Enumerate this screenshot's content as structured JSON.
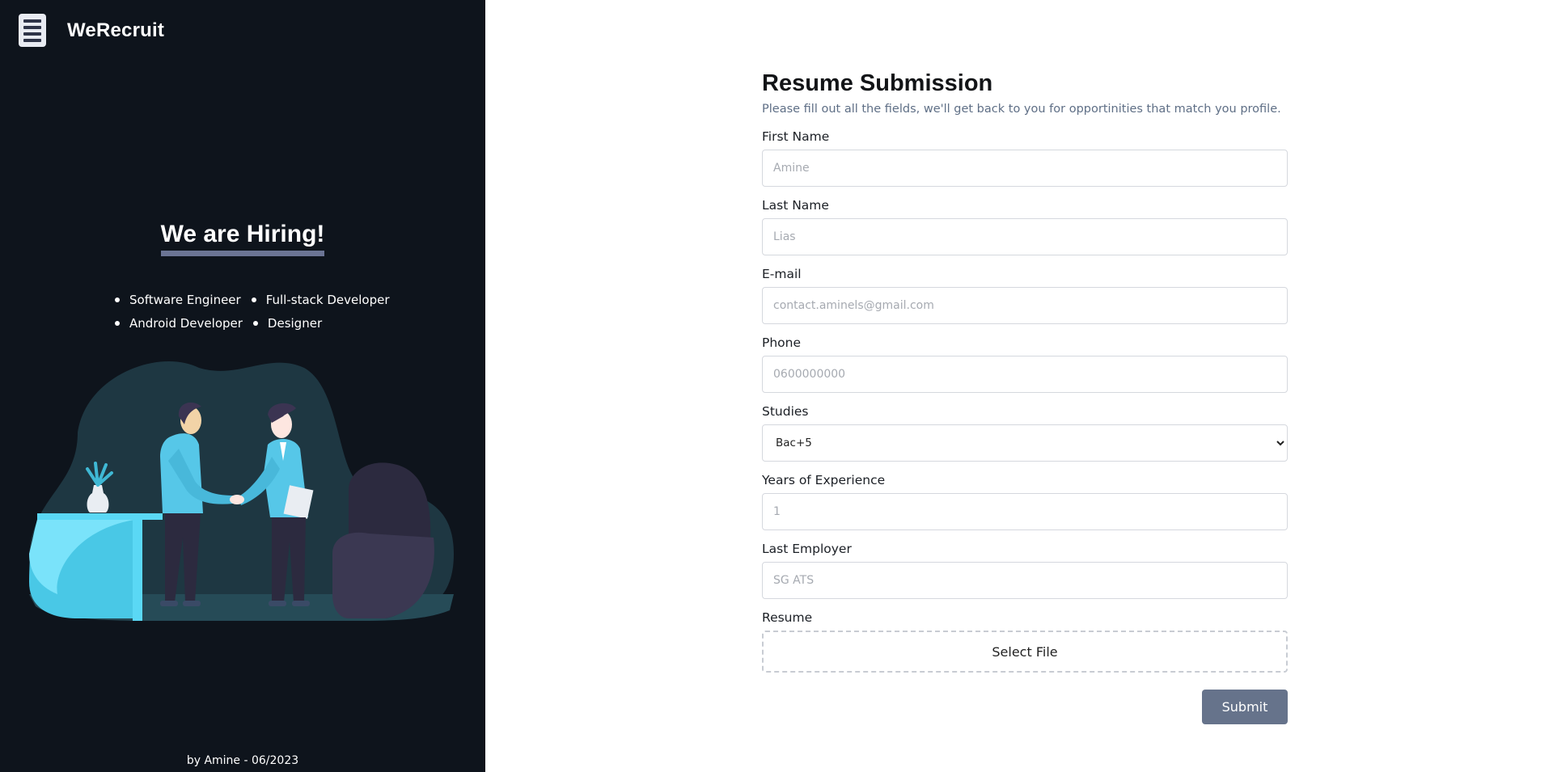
{
  "brand": {
    "name": "WeRecruit",
    "icon": "document-lines-icon"
  },
  "hero": {
    "title": "We are Hiring!",
    "roles": [
      "Software Engineer",
      "Full-stack Developer",
      "Android Developer",
      "Designer"
    ],
    "illustration": "handshake-illustration"
  },
  "footer": {
    "credit": "by Amine - 06/2023"
  },
  "form": {
    "title": "Resume Submission",
    "subtitle": "Please fill out all the fields, we'll get back to you for opportinities that match you profile.",
    "first_name": {
      "label": "First Name",
      "placeholder": "Amine"
    },
    "last_name": {
      "label": "Last Name",
      "placeholder": "Lias"
    },
    "email": {
      "label": "E-mail",
      "placeholder": "contact.aminels@gmail.com"
    },
    "phone": {
      "label": "Phone",
      "placeholder": "0600000000"
    },
    "studies": {
      "label": "Studies",
      "selected": "Bac+5"
    },
    "experience": {
      "label": "Years of Experience",
      "placeholder": "1"
    },
    "employer": {
      "label": "Last Employer",
      "placeholder": "SG ATS"
    },
    "resume": {
      "label": "Resume",
      "button": "Select File"
    },
    "submit": "Submit"
  },
  "colors": {
    "sidebar_bg": "#0e141c",
    "accent_underline": "#6b7494",
    "submit_bg": "#66738b",
    "illustration_cyan": "#5ad8f5"
  }
}
